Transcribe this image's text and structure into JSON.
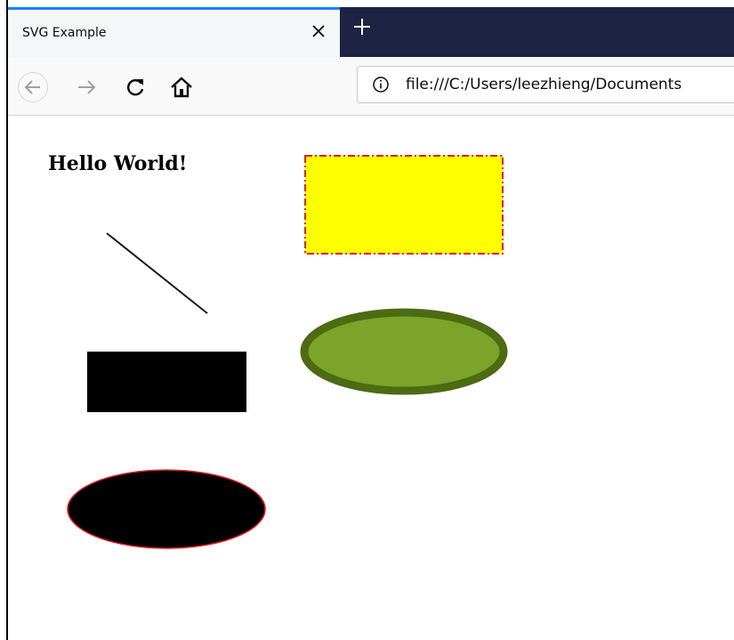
{
  "browser": {
    "tab": {
      "title": "SVG Example",
      "close_icon": "close-icon"
    },
    "new_tab_icon": "plus-icon",
    "nav": {
      "back_icon": "arrow-left-icon",
      "forward_icon": "arrow-right-icon",
      "reload_icon": "reload-icon",
      "home_icon": "home-icon"
    },
    "address_bar": {
      "info_icon": "info-icon",
      "url": "file:///C:/Users/leezhieng/Documents"
    },
    "colors": {
      "tab_accent": "#0a84ff",
      "tabbar_bg": "#1e2344"
    }
  },
  "page": {
    "heading": "Hello World!",
    "shapes": {
      "line": {
        "stroke": "#1a1a1a"
      },
      "black_rect": {
        "fill": "#000000"
      },
      "black_ellipse": {
        "fill": "#000000",
        "stroke": "#e0201e"
      },
      "yellow_rect": {
        "fill": "#ffff00",
        "stroke": "#e0201e",
        "dash": "dash-dot"
      },
      "green_ellipse": {
        "fill": "#7ca32a",
        "stroke": "#4c6b12"
      }
    }
  }
}
